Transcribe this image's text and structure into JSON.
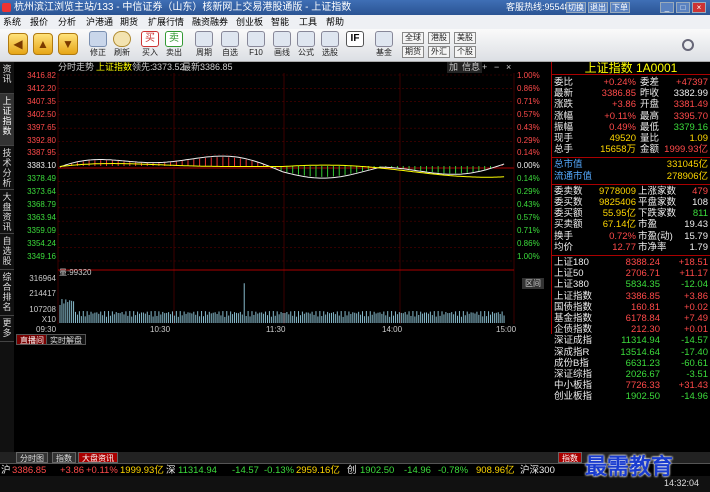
{
  "window": {
    "title": "杭州滨江浏览主站/133 - 中信证券（山东）核新网上交易港股通版 - 上证指数",
    "hotline_label": "客服热线:",
    "hotline_number": "95548",
    "btn_qiehuan": "切换",
    "btn_tuichu": "退出",
    "btn_xiadan": "下单"
  },
  "menu": [
    "系统",
    "报价",
    "分析",
    "沪港通",
    "期货",
    "扩展行情",
    "融资融券",
    "创业板",
    "智能",
    "工具",
    "帮助"
  ],
  "toolbar": {
    "buttons": [
      {
        "label": "修正",
        "icon": "pencil-icon"
      },
      {
        "label": "刷新",
        "icon": "clock-icon"
      },
      {
        "label": "买入",
        "icon": "buy-icon"
      },
      {
        "label": "卖出",
        "icon": "sell-icon"
      },
      {
        "label": "周期",
        "icon": "period-icon"
      },
      {
        "label": "自选",
        "icon": "watchlist-icon"
      },
      {
        "label": "F10",
        "icon": "f10-icon"
      },
      {
        "label": "画线",
        "icon": "drawline-icon"
      },
      {
        "label": "公式",
        "icon": "formula-icon"
      },
      {
        "label": "选股",
        "icon": "stockpick-icon"
      },
      {
        "label": "基金",
        "icon": "fund-icon"
      }
    ],
    "toggles": [
      "全球",
      "港股",
      "美股",
      "期货",
      "外汇",
      "个股"
    ],
    "if_label": "IF"
  },
  "left_tabs": [
    "资讯",
    "上证指数",
    "技术分析",
    "大盘资讯",
    "自选股",
    "综合排名",
    "更多"
  ],
  "chart": {
    "header": {
      "mode": "分时走势",
      "name": "上证指数",
      "lead_label": "领先:",
      "lead_value": "3373.52",
      "latest_label": "最新:",
      "latest_value": "3386.85"
    },
    "right_tools": [
      "加",
      "信息"
    ],
    "left_axis": [
      "3416.82",
      "3412.20",
      "3407.35",
      "3402.50",
      "3397.65",
      "3392.80",
      "3387.95",
      "3383.10",
      "3378.49",
      "3373.64",
      "3368.79",
      "3363.94",
      "3359.09",
      "3354.24",
      "3349.16"
    ],
    "right_axis": [
      "1.00%",
      "0.86%",
      "0.71%",
      "0.57%",
      "0.43%",
      "0.29%",
      "0.14%",
      "0.00%",
      "0.14%",
      "0.29%",
      "0.43%",
      "0.57%",
      "0.71%",
      "0.86%",
      "1.00%"
    ],
    "volume_label": "量:",
    "volume_value": "99320",
    "volume_axis": [
      "316964",
      "214417",
      "107208",
      "X10"
    ],
    "volume_btn": "区间",
    "time_labels": [
      "09:30",
      "10:30",
      "11:30",
      "14:00",
      "15:00"
    ]
  },
  "lower_tabs": [
    "直播间",
    "实时解盘"
  ],
  "right_panel": {
    "title": "上证指数 1A0001",
    "rows": [
      {
        "l": "委比",
        "v": "+0.24%",
        "l2": "委差",
        "v2": "+47397"
      },
      {
        "l": "最新",
        "v": "3386.85",
        "l2": "昨收",
        "v2": "3382.99"
      },
      {
        "l": "涨跌",
        "v": "+3.86",
        "l2": "开盘",
        "v2": "3381.49"
      },
      {
        "l": "涨幅",
        "v": "+0.11%",
        "l2": "最高",
        "v2": "3395.70"
      },
      {
        "l": "振幅",
        "v": "0.49%",
        "l2": "最低",
        "v2": "3379.16"
      },
      {
        "l": "现手",
        "v": "49520",
        "l2": "量比",
        "v2": "1.09"
      },
      {
        "l": "总手",
        "v": "15658万",
        "l2": "金额",
        "v2": "1999.93亿"
      }
    ],
    "cap_rows": [
      {
        "l": "总市值",
        "v": "331045亿"
      },
      {
        "l": "流通市值",
        "v": "278906亿"
      }
    ],
    "stat_rows": [
      {
        "l": "委卖数",
        "v": "9778009",
        "l2": "上涨家数",
        "v2": "479"
      },
      {
        "l": "委买数",
        "v": "9825406",
        "l2": "平盘家数",
        "v2": "108"
      },
      {
        "l": "委买额",
        "v": "55.95亿",
        "l2": "下跌家数",
        "v2": "811"
      },
      {
        "l": "买卖额",
        "v": "67.14亿",
        "l2": "市盈",
        "v2": "19.43"
      },
      {
        "l": "换手",
        "v": "0.72%",
        "l2": "市盈(动)",
        "v2": "15.79"
      },
      {
        "l": "均价",
        "v": "12.77",
        "l2": "市净率",
        "v2": "1.79"
      }
    ],
    "index_rows": [
      {
        "n": "上证180",
        "p": "8388.24",
        "c": "+18.51"
      },
      {
        "n": "上证50",
        "p": "2706.71",
        "c": "+11.17"
      },
      {
        "n": "上证380",
        "p": "5834.35",
        "c": "-12.04"
      },
      {
        "n": "上证指数",
        "p": "3386.85",
        "c": "+3.86"
      },
      {
        "n": "国债指数",
        "p": "160.81",
        "c": "+0.02"
      },
      {
        "n": "基金指数",
        "p": "6178.84",
        "c": "+7.49"
      },
      {
        "n": "企债指数",
        "p": "212.30",
        "c": "+0.01"
      },
      {
        "n": "深证成指",
        "p": "11314.94",
        "c": "-14.57"
      },
      {
        "n": "深成指R",
        "p": "13514.64",
        "c": "-17.40"
      },
      {
        "n": "成份B指",
        "p": "6631.23",
        "c": "-60.61"
      },
      {
        "n": "深证综指",
        "p": "2026.67",
        "c": "-3.51"
      },
      {
        "n": "中小板指",
        "p": "7726.33",
        "c": "+31.43"
      },
      {
        "n": "创业板指",
        "p": "1902.50",
        "c": "-14.96"
      }
    ]
  },
  "bottom_tabs": [
    "分时图",
    "指数",
    "大盘资讯"
  ],
  "bottom_right_tab": "指数",
  "status": {
    "sh_label": "沪",
    "sh_price": "3386.85",
    "sh_chg": "+3.86",
    "sh_pct": "+0.11%",
    "sh_amt": "1999.93亿",
    "sz_label": "深",
    "sz_price": "11314.94",
    "sz_chg": "-14.57",
    "sz_pct": "-0.13%",
    "sz_amt": "2959.16亿",
    "cy_label": "创",
    "cy_price": "1902.50",
    "cy_chg": "-14.96",
    "cy_pct": "-0.78%",
    "cy_amt": "908.96亿",
    "sz300_label": "沪深300"
  },
  "watermark": "最需教育",
  "clock": "14:32:04"
}
